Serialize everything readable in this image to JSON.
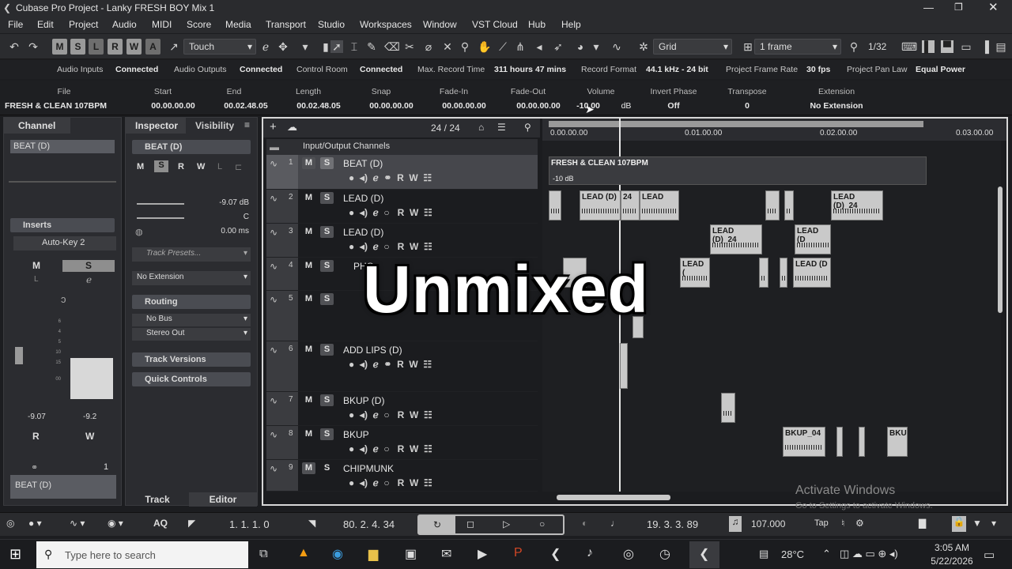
{
  "window": {
    "title": "Cubase Pro Project - Lanky FRESH BOY Mix 1"
  },
  "menu": [
    "File",
    "Edit",
    "Project",
    "Audio",
    "MIDI",
    "Score",
    "Media",
    "Transport",
    "Studio",
    "Workspaces",
    "Window",
    "VST Cloud",
    "Hub",
    "Help"
  ],
  "toolbar": {
    "ms_buttons": [
      "M",
      "S",
      "L",
      "R",
      "W",
      "A"
    ],
    "automation_mode": "Touch",
    "grid_mode": "Grid",
    "quantize": "1 frame",
    "zoom_display": "1/32"
  },
  "status": {
    "audio_inputs_label": "Audio Inputs",
    "audio_inputs_value": "Connected",
    "audio_outputs_label": "Audio Outputs",
    "audio_outputs_value": "Connected",
    "control_room_label": "Control Room",
    "control_room_value": "Connected",
    "max_record_label": "Max. Record Time",
    "max_record_value": "311 hours 47 mins",
    "record_format_label": "Record Format",
    "record_format_value": "44.1 kHz - 24 bit",
    "frame_rate_label": "Project Frame Rate",
    "frame_rate_value": "30 fps",
    "pan_law_label": "Project Pan Law",
    "pan_law_value": "Equal Power"
  },
  "infoline": {
    "file_label": "File",
    "file_value": "FRESH & CLEAN 107BPM",
    "start_label": "Start",
    "start_value": "00.00.00.00",
    "end_label": "End",
    "end_value": "00.02.48.05",
    "length_label": "Length",
    "length_value": "00.02.48.05",
    "snap_label": "Snap",
    "snap_value": "00.00.00.00",
    "fadein_label": "Fade-In",
    "fadein_value": "00.00.00.00",
    "fadeout_label": "Fade-Out",
    "fadeout_value": "00.00.00.00",
    "volume_label": "Volume",
    "volume_value": "-10.00",
    "volume_unit": "dB",
    "invert_label": "Invert Phase",
    "invert_value": "Off",
    "transpose_label": "Transpose",
    "transpose_value": "0",
    "extension_label": "Extension",
    "extension_value": "No Extension"
  },
  "channel": {
    "tab_label": "Channel",
    "track_name": "BEAT (D)",
    "inserts_label": "Inserts",
    "insert_slot": "Auto-Key 2",
    "m": "M",
    "s": "S",
    "l": "L",
    "fader_left_value": "-9.07",
    "fader_right_value": "-9.2",
    "r": "R",
    "w": "W",
    "channel_number": "1",
    "bottom_name": "BEAT (D)",
    "scale": [
      "6",
      "5",
      "10",
      "15",
      "00"
    ],
    "scale_right": [
      "0",
      "6",
      "12",
      "18"
    ]
  },
  "inspector": {
    "tab_inspector": "Inspector",
    "tab_visibility": "Visibility",
    "track_name": "BEAT (D)",
    "volume_value": "-9.07 dB",
    "pan_value": "C",
    "delay_value": "0.00 ms",
    "track_presets_placeholder": "Track Presets...",
    "extension": "No Extension",
    "routing_label": "Routing",
    "input_routing": "No Bus",
    "output_routing": "Stereo Out",
    "track_versions_label": "Track Versions",
    "quick_controls_label": "Quick Controls",
    "bottom_tab_track": "Track",
    "bottom_tab_editor": "Editor"
  },
  "tracklist": {
    "count": "24 / 24",
    "folder_label": "Input/Output Channels",
    "tracks": [
      {
        "num": "1",
        "name": "BEAT (D)"
      },
      {
        "num": "2",
        "name": "LEAD (D)"
      },
      {
        "num": "3",
        "name": "LEAD (D)"
      },
      {
        "num": "4",
        "name": "PHO"
      },
      {
        "num": "5",
        "name": "LIP"
      },
      {
        "num": "6",
        "name": "ADD LIPS (D)"
      },
      {
        "num": "7",
        "name": "BKUP (D)"
      },
      {
        "num": "8",
        "name": "BKUP"
      },
      {
        "num": "9",
        "name": "CHIPMUNK"
      }
    ]
  },
  "ruler": [
    "0.00.00.00",
    "0.01.00.00",
    "0.02.00.00",
    "0.03.00.00"
  ],
  "clips": {
    "beat_name": "FRESH & CLEAN 107BPM",
    "beat_volume": "-10 dB",
    "lead_a": "LEAD (D)",
    "lead_a_suffix": "24",
    "lead_b": "LEAD",
    "lead_c": "LEAD (D)_24",
    "lead_d": "LEAD (D)_24",
    "lead_e": "LEAD (D",
    "lead_f": "LEAD (D",
    "lead_g": "LEAD (",
    "lead_h": "LEAD (D",
    "bkup_a": "BKUP_04",
    "bkup_b": "BKUI"
  },
  "overlay_text": "Unmixed",
  "watermark": {
    "line1": "Activate Windows",
    "line2": "Go to Settings to activate Windows."
  },
  "transport": {
    "aq": "AQ",
    "left_locator": "1. 1. 1.   0",
    "right_locator": "80. 2. 4. 34",
    "position": "19. 3. 3. 89",
    "tempo": "107.000",
    "tap": "Tap"
  },
  "taskbar": {
    "search_placeholder": "Type here to search",
    "temperature": "28°C",
    "time": "3:05 AM",
    "date": "5/22/2026"
  },
  "colors": {
    "accent": "#ffffff",
    "clip": "#c9c9c9",
    "panel": "#2b2c30"
  }
}
